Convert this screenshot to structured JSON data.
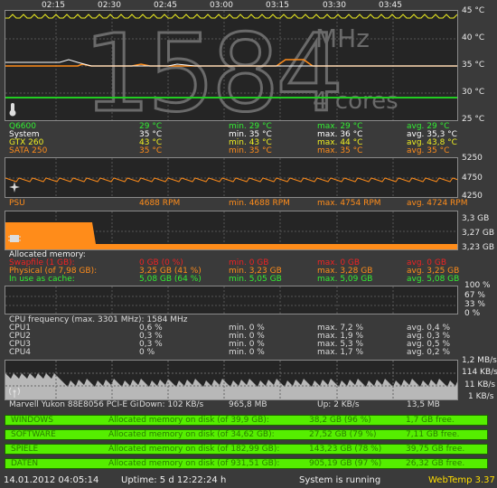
{
  "times": [
    "02:15",
    "02:30",
    "02:45",
    "03:00",
    "03:15",
    "03:30",
    "03:45"
  ],
  "temp": {
    "big_value": "1584",
    "unit": "MHz",
    "cores": "4 cores",
    "axis": [
      "45 °C",
      "40 °C",
      "35 °C",
      "30 °C",
      "25 °C"
    ],
    "rows": [
      {
        "name": "Q6600",
        "cur": "29 °C",
        "min": "min. 29 °C",
        "max": "max. 29 °C",
        "avg": "avg. 29 °C",
        "color": "#33ee33"
      },
      {
        "name": "System",
        "cur": "35 °C",
        "min": "min. 35 °C",
        "max": "max. 36 °C",
        "avg": "avg. 35,3 °C",
        "color": "#ffffff"
      },
      {
        "name": "GTX 260",
        "cur": "43 °C",
        "min": "min. 43 °C",
        "max": "max. 44 °C",
        "avg": "avg. 43,8 °C",
        "color": "#eeee22"
      },
      {
        "name": "SATA 250",
        "cur": "35 °C",
        "min": "min. 35 °C",
        "max": "max. 35 °C",
        "avg": "avg. 35 °C",
        "color": "#ff8c1a"
      }
    ]
  },
  "fan": {
    "axis": [
      "5250",
      "4750",
      "4250"
    ],
    "row": {
      "name": "PSU",
      "cur": "4688 RPM",
      "min": "min. 4688 RPM",
      "max": "max. 4754 RPM",
      "avg": "avg. 4724 RPM",
      "color": "#ff8c1a"
    }
  },
  "memory": {
    "axis": [
      "3,3 GB",
      "3,27 GB",
      "3,23 GB"
    ],
    "title": "Allocated memory:",
    "rows": [
      {
        "name": "Swapfile (1 GB):",
        "cur": "0 GB (0 %)",
        "min": "min. 0 GB",
        "max": "max. 0 GB",
        "avg": "avg. 0 GB",
        "color": "#ee2222"
      },
      {
        "name": "Physical (of 7,98 GB):",
        "cur": "3,25 GB (41 %)",
        "min": "min. 3,23 GB",
        "max": "max. 3,28 GB",
        "avg": "avg. 3,25 GB",
        "color": "#ff8c1a"
      },
      {
        "name": "In use as cache:",
        "cur": "5,08 GB (64 %)",
        "min": "min. 5,05 GB",
        "max": "max. 5,09 GB",
        "avg": "avg. 5,08 GB",
        "color": "#33ee33"
      }
    ]
  },
  "cpu": {
    "axis": [
      "100 %",
      "67 %",
      "33 %",
      "0 %"
    ],
    "title": "CPU frequency (max. 3301 MHz): 1584 MHz",
    "rows": [
      {
        "name": "CPU1",
        "cur": "0,6 %",
        "min": "min. 0 %",
        "max": "max. 7,2 %",
        "avg": "avg. 0,4 %"
      },
      {
        "name": "CPU2",
        "cur": "0,3 %",
        "min": "min. 0 %",
        "max": "max. 1,9 %",
        "avg": "avg. 0,3 %"
      },
      {
        "name": "CPU3",
        "cur": "0,3 %",
        "min": "min. 0 %",
        "max": "max. 5,3 %",
        "avg": "avg. 0,5 %"
      },
      {
        "name": "CPU4",
        "cur": "0 %",
        "min": "min. 0 %",
        "max": "max. 1,7 %",
        "avg": "avg. 0,2 %"
      }
    ]
  },
  "network": {
    "axis": [
      "1,2 MB/s",
      "114 KB/s",
      "11 KB/s",
      "1 KB/s"
    ],
    "adapter": "Marvell Yukon 88E8056 PCI-E Gi",
    "down": "Down: 102 KB/s",
    "down_total": "965,8 MB",
    "up": "Up: 2 KB/s",
    "up_total": "13,5 MB"
  },
  "disks": [
    {
      "name": "WINDOWS",
      "info": "Allocated memory on disk (of 39,9 GB):",
      "used": "38,2 GB (96 %)",
      "free": "1,7 GB free."
    },
    {
      "name": "SOFTWARE",
      "info": "Allocated memory on disk (of 34,62 GB):",
      "used": "27,52 GB (79 %)",
      "free": "7,11 GB free."
    },
    {
      "name": "SPIELE",
      "info": "Allocated memory on disk (of 182,99 GB):",
      "used": "143,23 GB (78 %)",
      "free": "39,75 GB free."
    },
    {
      "name": "DATEN",
      "info": "Allocated memory on disk (of 931,51 GB):",
      "used": "905,19 GB (97 %)",
      "free": "26,32 GB free."
    }
  ],
  "status": {
    "datetime": "14.01.2012 04:05:14",
    "uptime": "Uptime: 5 d 12:22:24 h",
    "state": "System is running",
    "app": "WebTemp 3.37"
  }
}
